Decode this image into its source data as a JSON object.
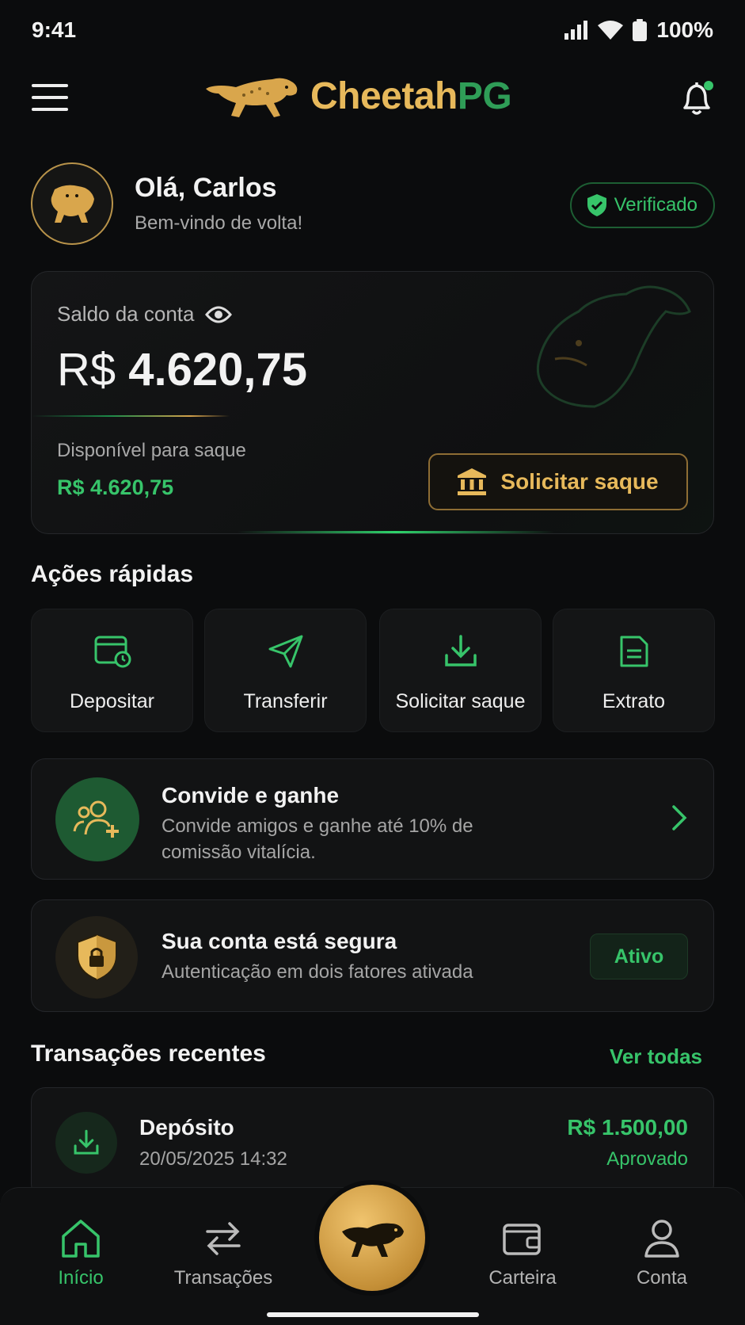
{
  "status_bar": {
    "time": "9:41",
    "battery": "100%"
  },
  "header": {
    "logo_part1": "Cheetah",
    "logo_part2": "PG",
    "notification_dot": true
  },
  "greeting": {
    "hello": "Olá, Carlos",
    "welcome": "Bem-vindo de volta!",
    "verified_label": "Verificado"
  },
  "balance": {
    "label": "Saldo da conta",
    "currency": "R$",
    "amount": "4.620,75",
    "available_label": "Disponível para saque",
    "available_value": "R$ 4.620,75",
    "withdraw_button": "Solicitar saque"
  },
  "quick_actions": {
    "title": "Ações rápidas",
    "items": [
      {
        "label": "Depositar",
        "icon": "wallet-clock-icon"
      },
      {
        "label": "Transferir",
        "icon": "send-icon"
      },
      {
        "label": "Solicitar saque",
        "icon": "download-icon"
      },
      {
        "label": "Extrato",
        "icon": "document-icon"
      }
    ]
  },
  "invite": {
    "title": "Convide e ganhe",
    "description": "Convide amigos e ganhe até 10% de comissão vitalícia."
  },
  "security": {
    "title": "Sua conta está segura",
    "description": "Autenticação em dois fatores ativada",
    "badge": "Ativo"
  },
  "transactions": {
    "title": "Transações recentes",
    "see_all": "Ver todas",
    "items": [
      {
        "type": "Depósito",
        "datetime": "20/05/2025 14:32",
        "amount": "R$ 1.500,00",
        "status": "Aprovado"
      }
    ]
  },
  "bottom_nav": {
    "items": [
      {
        "label": "Início",
        "icon": "home-icon",
        "active": true
      },
      {
        "label": "Transações",
        "icon": "arrows-icon",
        "active": false
      },
      {
        "label": "Carteira",
        "icon": "wallet-icon",
        "active": false
      },
      {
        "label": "Conta",
        "icon": "user-icon",
        "active": false
      }
    ]
  },
  "colors": {
    "accent_green": "#37c46a",
    "accent_gold": "#e7b95b",
    "background": "#0b0c0d"
  }
}
